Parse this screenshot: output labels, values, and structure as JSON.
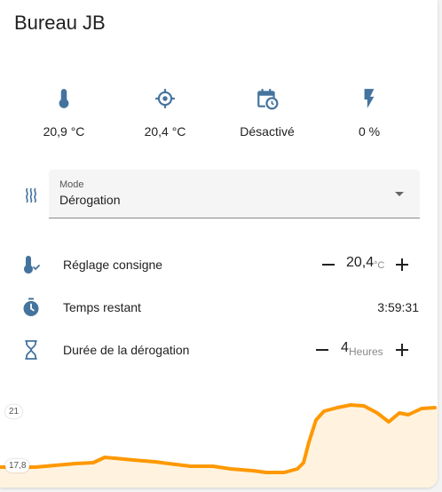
{
  "card": {
    "title": "Bureau JB"
  },
  "stats": [
    {
      "icon": "thermometer-icon",
      "value": "20,9 °C"
    },
    {
      "icon": "crosshairs-gps-icon",
      "value": "20,4 °C"
    },
    {
      "icon": "calendar-clock-icon",
      "value": "Désactivé"
    },
    {
      "icon": "flash-icon",
      "value": "0 %"
    }
  ],
  "mode": {
    "icon": "radiator-icon",
    "label": "Mode",
    "value": "Dérogation"
  },
  "setpoint": {
    "label": "Réglage consigne",
    "value": "20,4",
    "unit": "°C"
  },
  "remaining": {
    "label": "Temps restant",
    "value": "3:59:31"
  },
  "override": {
    "label": "Durée de la dérogation",
    "value": "4",
    "unit": "Heures"
  },
  "graph": {
    "y_labels": [
      "21",
      "17,8"
    ],
    "color": "#ff9800",
    "fill": "#fff3e0"
  },
  "colors": {
    "accent": "#ff9800",
    "icon": "#44739e"
  }
}
